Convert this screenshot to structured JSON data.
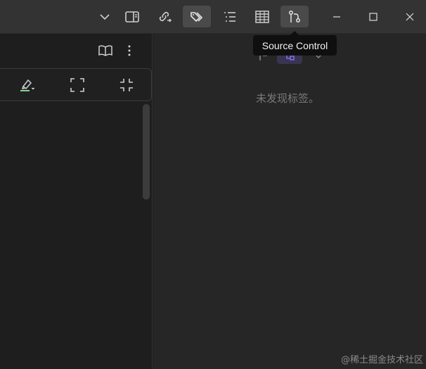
{
  "titlebar": {
    "buttons": [
      {
        "name": "chevron-down-icon"
      },
      {
        "name": "sidebar-toggle-icon"
      },
      {
        "name": "outgoing-links-icon"
      },
      {
        "name": "tags-icon"
      },
      {
        "name": "outline-icon"
      },
      {
        "name": "table-icon"
      },
      {
        "name": "source-control-icon"
      },
      {
        "name": "minimize-icon"
      },
      {
        "name": "maximize-icon"
      },
      {
        "name": "close-icon"
      }
    ]
  },
  "tooltip": {
    "text": "Source Control"
  },
  "left_pane": {
    "header_icons": [
      "reading-view-icon",
      "more-options-icon"
    ],
    "tools": [
      "highlighter-dropdown-icon",
      "expand-icon",
      "collapse-icon"
    ]
  },
  "right_pane": {
    "empty_message": "未发现标签。"
  },
  "watermark": {
    "text": "@稀土掘金技术社区"
  },
  "colors": {
    "titlebar_bg": "#333333",
    "pane_bg": "#1e1e1e",
    "right_pane_bg": "#262626",
    "accent": "#7f6df2",
    "highlighter_green": "#7bd88f"
  }
}
